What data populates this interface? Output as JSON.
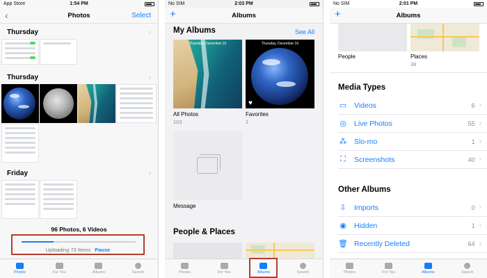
{
  "screen1": {
    "status": {
      "left": "App Store",
      "time": "1:54 PM"
    },
    "nav": {
      "back_icon": "chevron-left-icon",
      "title": "Photos",
      "right": "Select"
    },
    "sections": [
      {
        "title": "Thursday"
      },
      {
        "title": "Thursday"
      },
      {
        "title": "Friday"
      }
    ],
    "summary": "96 Photos, 6 Videos",
    "upload": {
      "text": "Uploading 73 Items",
      "action": "Pause",
      "progress_percent": 28
    }
  },
  "screen2": {
    "status": {
      "left": "No SIM",
      "time": "2:03 PM"
    },
    "nav": {
      "add_icon": "plus-icon",
      "title": "Albums"
    },
    "my_albums": {
      "title": "My Albums",
      "see_all": "See All",
      "thumb_date": "Thursday, December 16",
      "albums": [
        {
          "name": "All Photos",
          "count": "103"
        },
        {
          "name": "Favorites",
          "count": "1"
        },
        {
          "name": "Message",
          "count": ""
        }
      ]
    },
    "people_places": {
      "title": "People & Places"
    }
  },
  "screen3": {
    "status": {
      "left": "No SIM",
      "time": "2:01 PM"
    },
    "nav": {
      "add_icon": "plus-icon",
      "title": "Albums"
    },
    "top_albums": [
      {
        "name": "People",
        "count": ""
      },
      {
        "name": "Places",
        "count": "38"
      }
    ],
    "media_types": {
      "title": "Media Types",
      "rows": [
        {
          "label": "Videos",
          "count": "6",
          "icon": "video-icon"
        },
        {
          "label": "Live Photos",
          "count": "55",
          "icon": "live-photo-icon"
        },
        {
          "label": "Slo-mo",
          "count": "1",
          "icon": "slomo-icon"
        },
        {
          "label": "Screenshots",
          "count": "40",
          "icon": "screenshot-icon"
        }
      ]
    },
    "other_albums": {
      "title": "Other Albums",
      "rows": [
        {
          "label": "Imports",
          "count": "0",
          "icon": "import-icon"
        },
        {
          "label": "Hidden",
          "count": "1",
          "icon": "hidden-eye-icon"
        },
        {
          "label": "Recently Deleted",
          "count": "64",
          "icon": "trash-icon"
        }
      ]
    }
  },
  "tabs": [
    "Photos",
    "For You",
    "Albums",
    "Search"
  ],
  "colors": {
    "accent": "#147efb",
    "highlight": "#b23b2e"
  }
}
